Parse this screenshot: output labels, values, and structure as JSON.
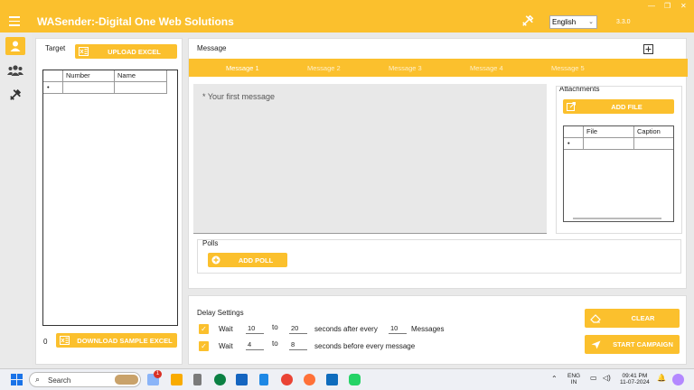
{
  "window": {
    "title": "WASender:-Digital One Web Solutions",
    "language": "English",
    "version": "3.3.0"
  },
  "target": {
    "label": "Target",
    "upload_button": "UPLOAD EXCEL",
    "columns": [
      "Number",
      "Name"
    ],
    "row_marker": "•",
    "count": "0",
    "download_button": "DOWNLOAD SAMPLE EXCEL"
  },
  "message": {
    "label": "Message",
    "tabs": [
      "Message 1",
      "Message 2",
      "Message 3",
      "Message 4",
      "Message 5"
    ],
    "placeholder": "* Your first message",
    "attachments_label": "Attachments",
    "add_file_button": "ADD FILE",
    "file_columns": [
      "File",
      "Caption"
    ],
    "row_marker": "•",
    "polls_label": "Polls",
    "add_poll_button": "ADD POLL"
  },
  "delay": {
    "label": "Delay Settings",
    "row1": {
      "wait": "Wait",
      "from": "10",
      "to_word": "to",
      "to": "20",
      "after": "seconds after every",
      "count": "10",
      "unit": "Messages"
    },
    "row2": {
      "wait": "Wait",
      "from": "4",
      "to_word": "to",
      "to": "8",
      "after": "seconds before every message"
    },
    "clear_button": "CLEAR",
    "start_button": "START CAMPAIGN"
  },
  "taskbar": {
    "search": "Search",
    "badge": "1",
    "lang1": "ENG",
    "lang2": "IN",
    "time": "09:41 PM",
    "date": "11-07-2024"
  },
  "colors": {
    "accent": "#fbc02d"
  }
}
